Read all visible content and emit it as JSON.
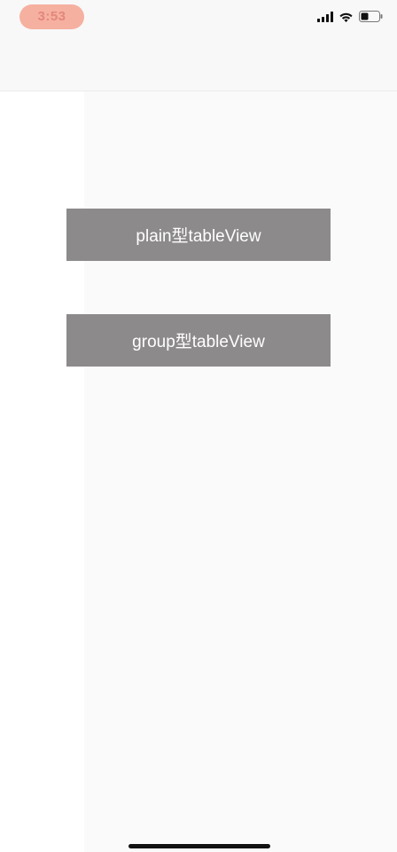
{
  "status_bar": {
    "time": "3:53",
    "icons": [
      "cellular-signal-icon",
      "wifi-icon",
      "battery-icon"
    ]
  },
  "buttons": {
    "plain_label": "plain型tableView",
    "group_label": "group型tableView"
  },
  "colors": {
    "button_bg": "#8d8a8b",
    "button_text": "#ffffff",
    "time_pill_bg": "#f6b0a0",
    "home_indicator": "#111111"
  }
}
